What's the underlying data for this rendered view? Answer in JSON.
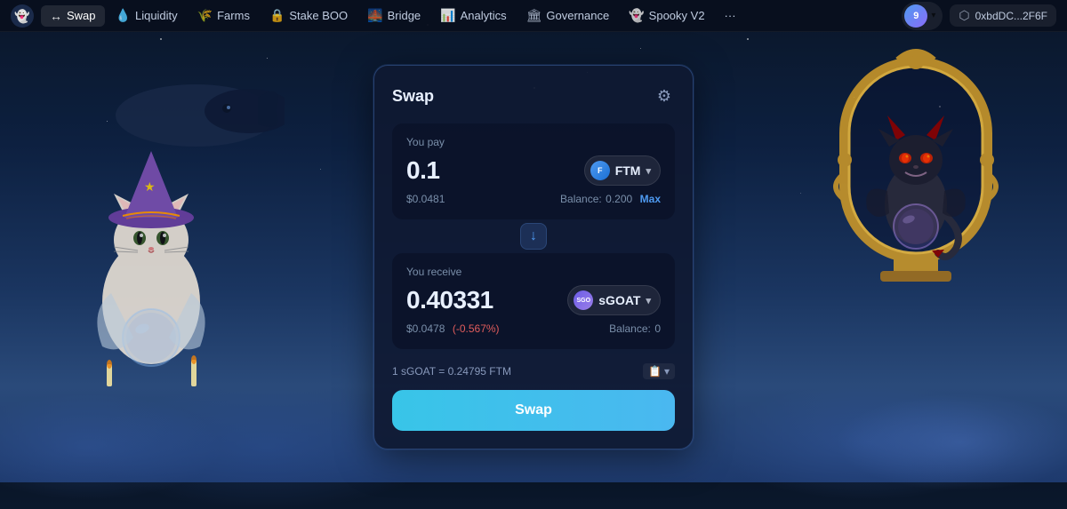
{
  "brand": {
    "logo_alt": "SpookySwap Logo"
  },
  "navbar": {
    "items": [
      {
        "id": "swap",
        "label": "Swap",
        "icon": "↔",
        "active": true
      },
      {
        "id": "liquidity",
        "label": "Liquidity",
        "icon": "💧",
        "active": false
      },
      {
        "id": "farms",
        "label": "Farms",
        "icon": "🌾",
        "active": false
      },
      {
        "id": "stake-boo",
        "label": "Stake BOO",
        "icon": "🔒",
        "active": false
      },
      {
        "id": "bridge",
        "label": "Bridge",
        "icon": "🌉",
        "active": false
      },
      {
        "id": "analytics",
        "label": "Analytics",
        "icon": "📊",
        "active": false
      },
      {
        "id": "governance",
        "label": "Governance",
        "icon": "🏛",
        "active": false
      },
      {
        "id": "spooky-v2",
        "label": "Spooky V2",
        "icon": "👻",
        "active": false
      }
    ],
    "more_label": "···",
    "avatar_number": "9",
    "wallet_address": "0xbdDC...2F6F",
    "chevron": "▾"
  },
  "swap": {
    "title": "Swap",
    "settings_icon": "⚙",
    "you_pay_label": "You pay",
    "pay_amount": "0.1",
    "pay_token": "FTM",
    "pay_usd": "$0.0481",
    "pay_balance_label": "Balance:",
    "pay_balance": "0.200",
    "max_label": "Max",
    "direction_icon": "↓",
    "you_receive_label": "You receive",
    "receive_amount": "0.40331",
    "receive_token": "sGOAT",
    "receive_token_short": "SGO",
    "receive_usd": "$0.0478",
    "price_impact": "(-0.567%)",
    "receive_balance_label": "Balance:",
    "receive_balance": "0",
    "rate_text": "1 sGOAT = 0.24795 FTM",
    "rate_icon": "📋",
    "rate_dropdown": "▾",
    "swap_button_label": "Swap"
  },
  "colors": {
    "accent_blue": "#4ab8f0",
    "accent_cyan": "#38c5e8",
    "accent_red": "#e05c5c",
    "max_color": "#4e9af1",
    "nav_bg": "#080f1e",
    "card_bg": "#0f1932"
  }
}
